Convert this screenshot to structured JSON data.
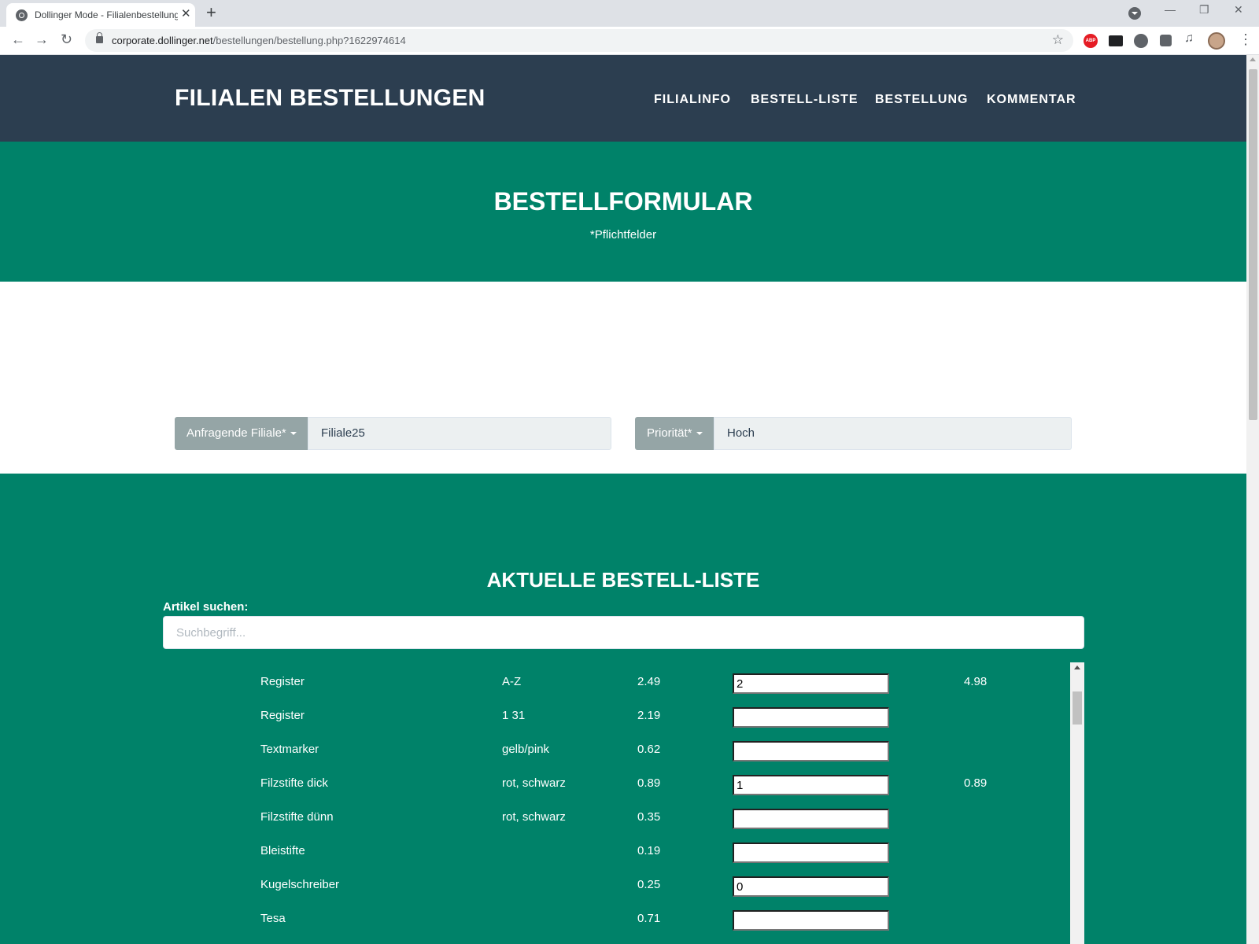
{
  "browser": {
    "tab_title": "Dollinger Mode - Filialenbestellung",
    "url_host": "corporate.dollinger.net",
    "url_path": "/bestellungen/bestellung.php?1622974614"
  },
  "navbar": {
    "brand": "FILIALEN BESTELLUNGEN",
    "links": [
      "FILIALINFO",
      "BESTELL-LISTE",
      "BESTELLUNG",
      "KOMMENTAR"
    ]
  },
  "hero": {
    "title": "BESTELLFORMULAR",
    "subtitle": "*Pflichtfelder"
  },
  "form": {
    "branch_label": "Anfragende Filiale*",
    "branch_value": "Filiale25",
    "priority_label": "Priorität*",
    "priority_value": "Hoch"
  },
  "order_list": {
    "title": "AKTUELLE BESTELL-LISTE",
    "search_label": "Artikel suchen:",
    "search_placeholder": "Suchbegriff...",
    "items": [
      {
        "name": "Register",
        "variant": "A-Z",
        "price": "2.49",
        "qty": "2",
        "total": "4.98"
      },
      {
        "name": "Register",
        "variant": "1 31",
        "price": "2.19",
        "qty": "",
        "total": ""
      },
      {
        "name": "Textmarker",
        "variant": "gelb/pink",
        "price": "0.62",
        "qty": "",
        "total": ""
      },
      {
        "name": "Filzstifte dick",
        "variant": "rot, schwarz",
        "price": "0.89",
        "qty": "1",
        "total": "0.89"
      },
      {
        "name": "Filzstifte dünn",
        "variant": "rot, schwarz",
        "price": "0.35",
        "qty": "",
        "total": ""
      },
      {
        "name": "Bleistifte",
        "variant": "",
        "price": "0.19",
        "qty": "",
        "total": ""
      },
      {
        "name": "Kugelschreiber",
        "variant": "",
        "price": "0.25",
        "qty": "0",
        "total": ""
      },
      {
        "name": "Tesa",
        "variant": "",
        "price": "0.71",
        "qty": "",
        "total": ""
      }
    ]
  },
  "icons": {
    "back": "arrow-left-icon",
    "forward": "arrow-right-icon",
    "reload": "reload-icon",
    "bookmark": "star-icon",
    "menu": "three-dots-icon"
  }
}
